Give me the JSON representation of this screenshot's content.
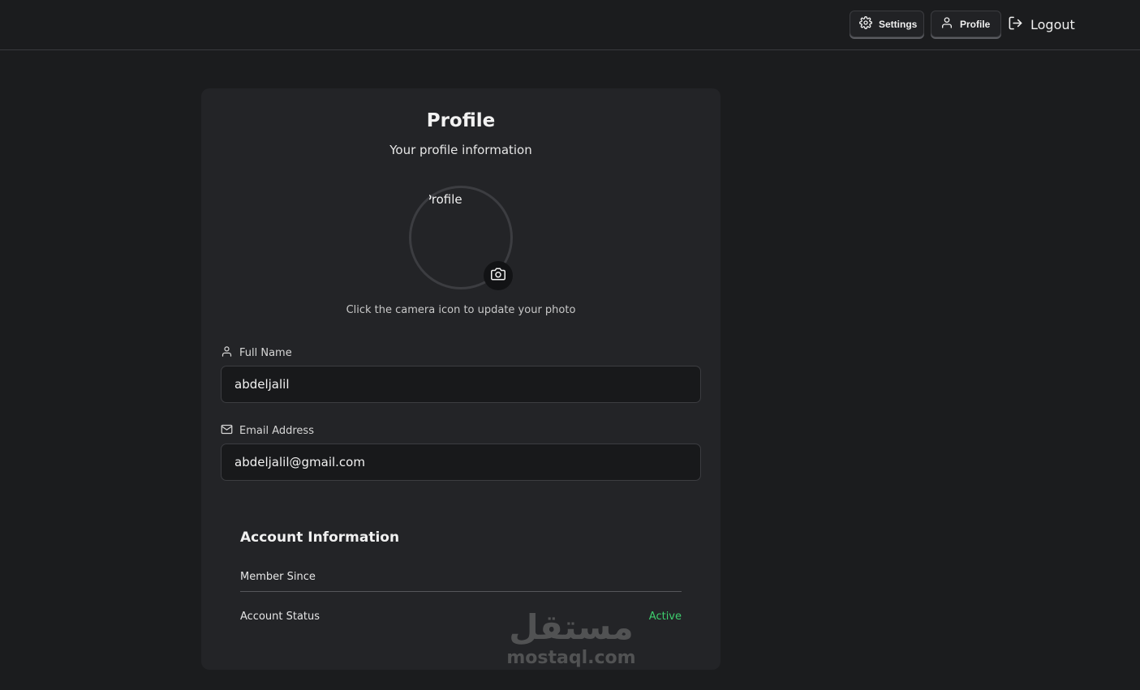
{
  "nav": {
    "settings_label": "Settings",
    "profile_label": "Profile",
    "logout_label": "Logout"
  },
  "profile": {
    "title": "Profile",
    "subtitle": "Your profile information",
    "avatar_alt": "Profile",
    "photo_hint": "Click the camera icon to update your photo"
  },
  "fields": {
    "full_name_label": "Full Name",
    "full_name_value": "abdeljalil",
    "email_label": "Email Address",
    "email_value": "abdeljalil@gmail.com"
  },
  "account": {
    "title": "Account Information",
    "member_since_label": "Member Since",
    "member_since_value": "",
    "status_label": "Account Status",
    "status_value": "Active"
  },
  "watermark": {
    "arabic": "مستقل",
    "latin": "mostaql.com"
  },
  "colors": {
    "background": "#1b1c1e",
    "card": "#232427",
    "status_active": "#3ecf6e"
  },
  "icons": {
    "settings": "gear-icon",
    "profile": "user-icon",
    "logout": "logout-icon",
    "camera": "camera-icon",
    "name": "user-icon",
    "email": "mail-icon"
  }
}
